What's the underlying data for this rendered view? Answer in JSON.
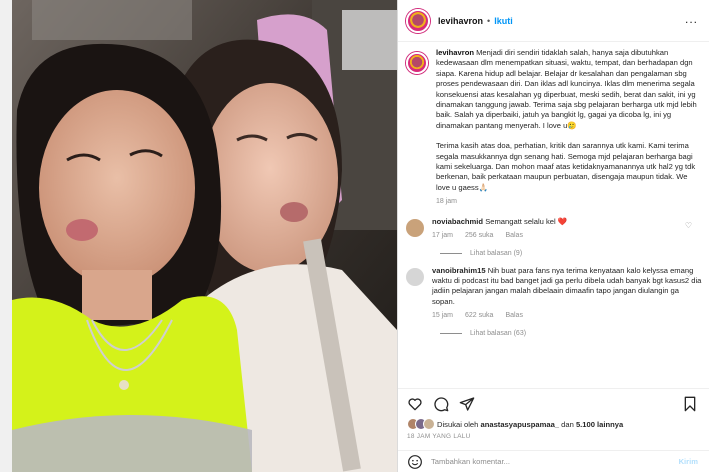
{
  "header": {
    "username": "levihavron",
    "dot": "•",
    "follow_label": "Ikuti",
    "more_label": "..."
  },
  "caption": {
    "username": "levihavron",
    "text_p1": "Menjadi diri sendiri tidaklah salah, hanya saja dibutuhkan kedewasaan dlm menempatkan situasi, waktu, tempat, dan berhadapan dgn siapa. Karena hidup adl belajar. Belajar dr kesalahan dan pengalaman sbg proses pendewasaan diri. Dan iklas adl kuncinya. Iklas dlm menerima segala konsekuensi atas kesalahan yg diperbuat, meski sedih, berat dan sakit, ini yg dinamakan tanggung jawab. Terima saja sbg pelajaran berharga utk mjd lebih baik. Salah ya diperbaiki, jatuh ya bangkit lg, gagai ya dicoba lg, ini yg dinamakan pantang menyerah. I love u🥲",
    "text_p2": "Terima kasih atas doa, perhatian, kritik dan sarannya utk kami. Kami terima segala masukkannya dgn senang hati. Semoga mjd pelajaran berharga bagi kami sekeluarga. Dan mohon maaf atas ketidaknyamanannya utk hal2 yg tdk berkenan, baik perkataan maupun perbuatan, disengaja maupun tidak. We love u gaess🙏🏻",
    "time": "18 jam"
  },
  "comments": [
    {
      "username": "noviabachmid",
      "text": "Semangatt selalu kel ❤️",
      "time": "17 jam",
      "likes": "256 suka",
      "reply": "Balas",
      "view_replies": "Lihat balasan (9)",
      "avatar_color": "#c9a27a"
    },
    {
      "username": "vanoibrahim15",
      "text": "Nih buat para fans nya terima kenyataan kalo kelyssa emang waktu di podcast itu bad banget jadi ga perlu dibela udah banyak bgt kasus2 dia jadiin pelajaran jangan malah dibelaain dimaafin tapo jangan diulangin ga sopan.",
      "time": "15 jam",
      "likes": "622 suka",
      "reply": "Balas",
      "view_replies": "Lihat balasan (63)",
      "avatar_color": "#d6d6d6"
    }
  ],
  "actions": {
    "liked_by_prefix": "Disukai oleh",
    "liked_by_user": "anastasyapuspamaa_",
    "liked_by_suffix": "dan",
    "liked_by_count": "5.100 lainnya",
    "timestamp": "18 JAM YANG LALU",
    "comment_placeholder": "Tambahkan komentar...",
    "post_label": "Kirim"
  },
  "colors": {
    "accent": "#0095f6",
    "heart": "#ed4956",
    "neon_top": "#d4f21a"
  }
}
